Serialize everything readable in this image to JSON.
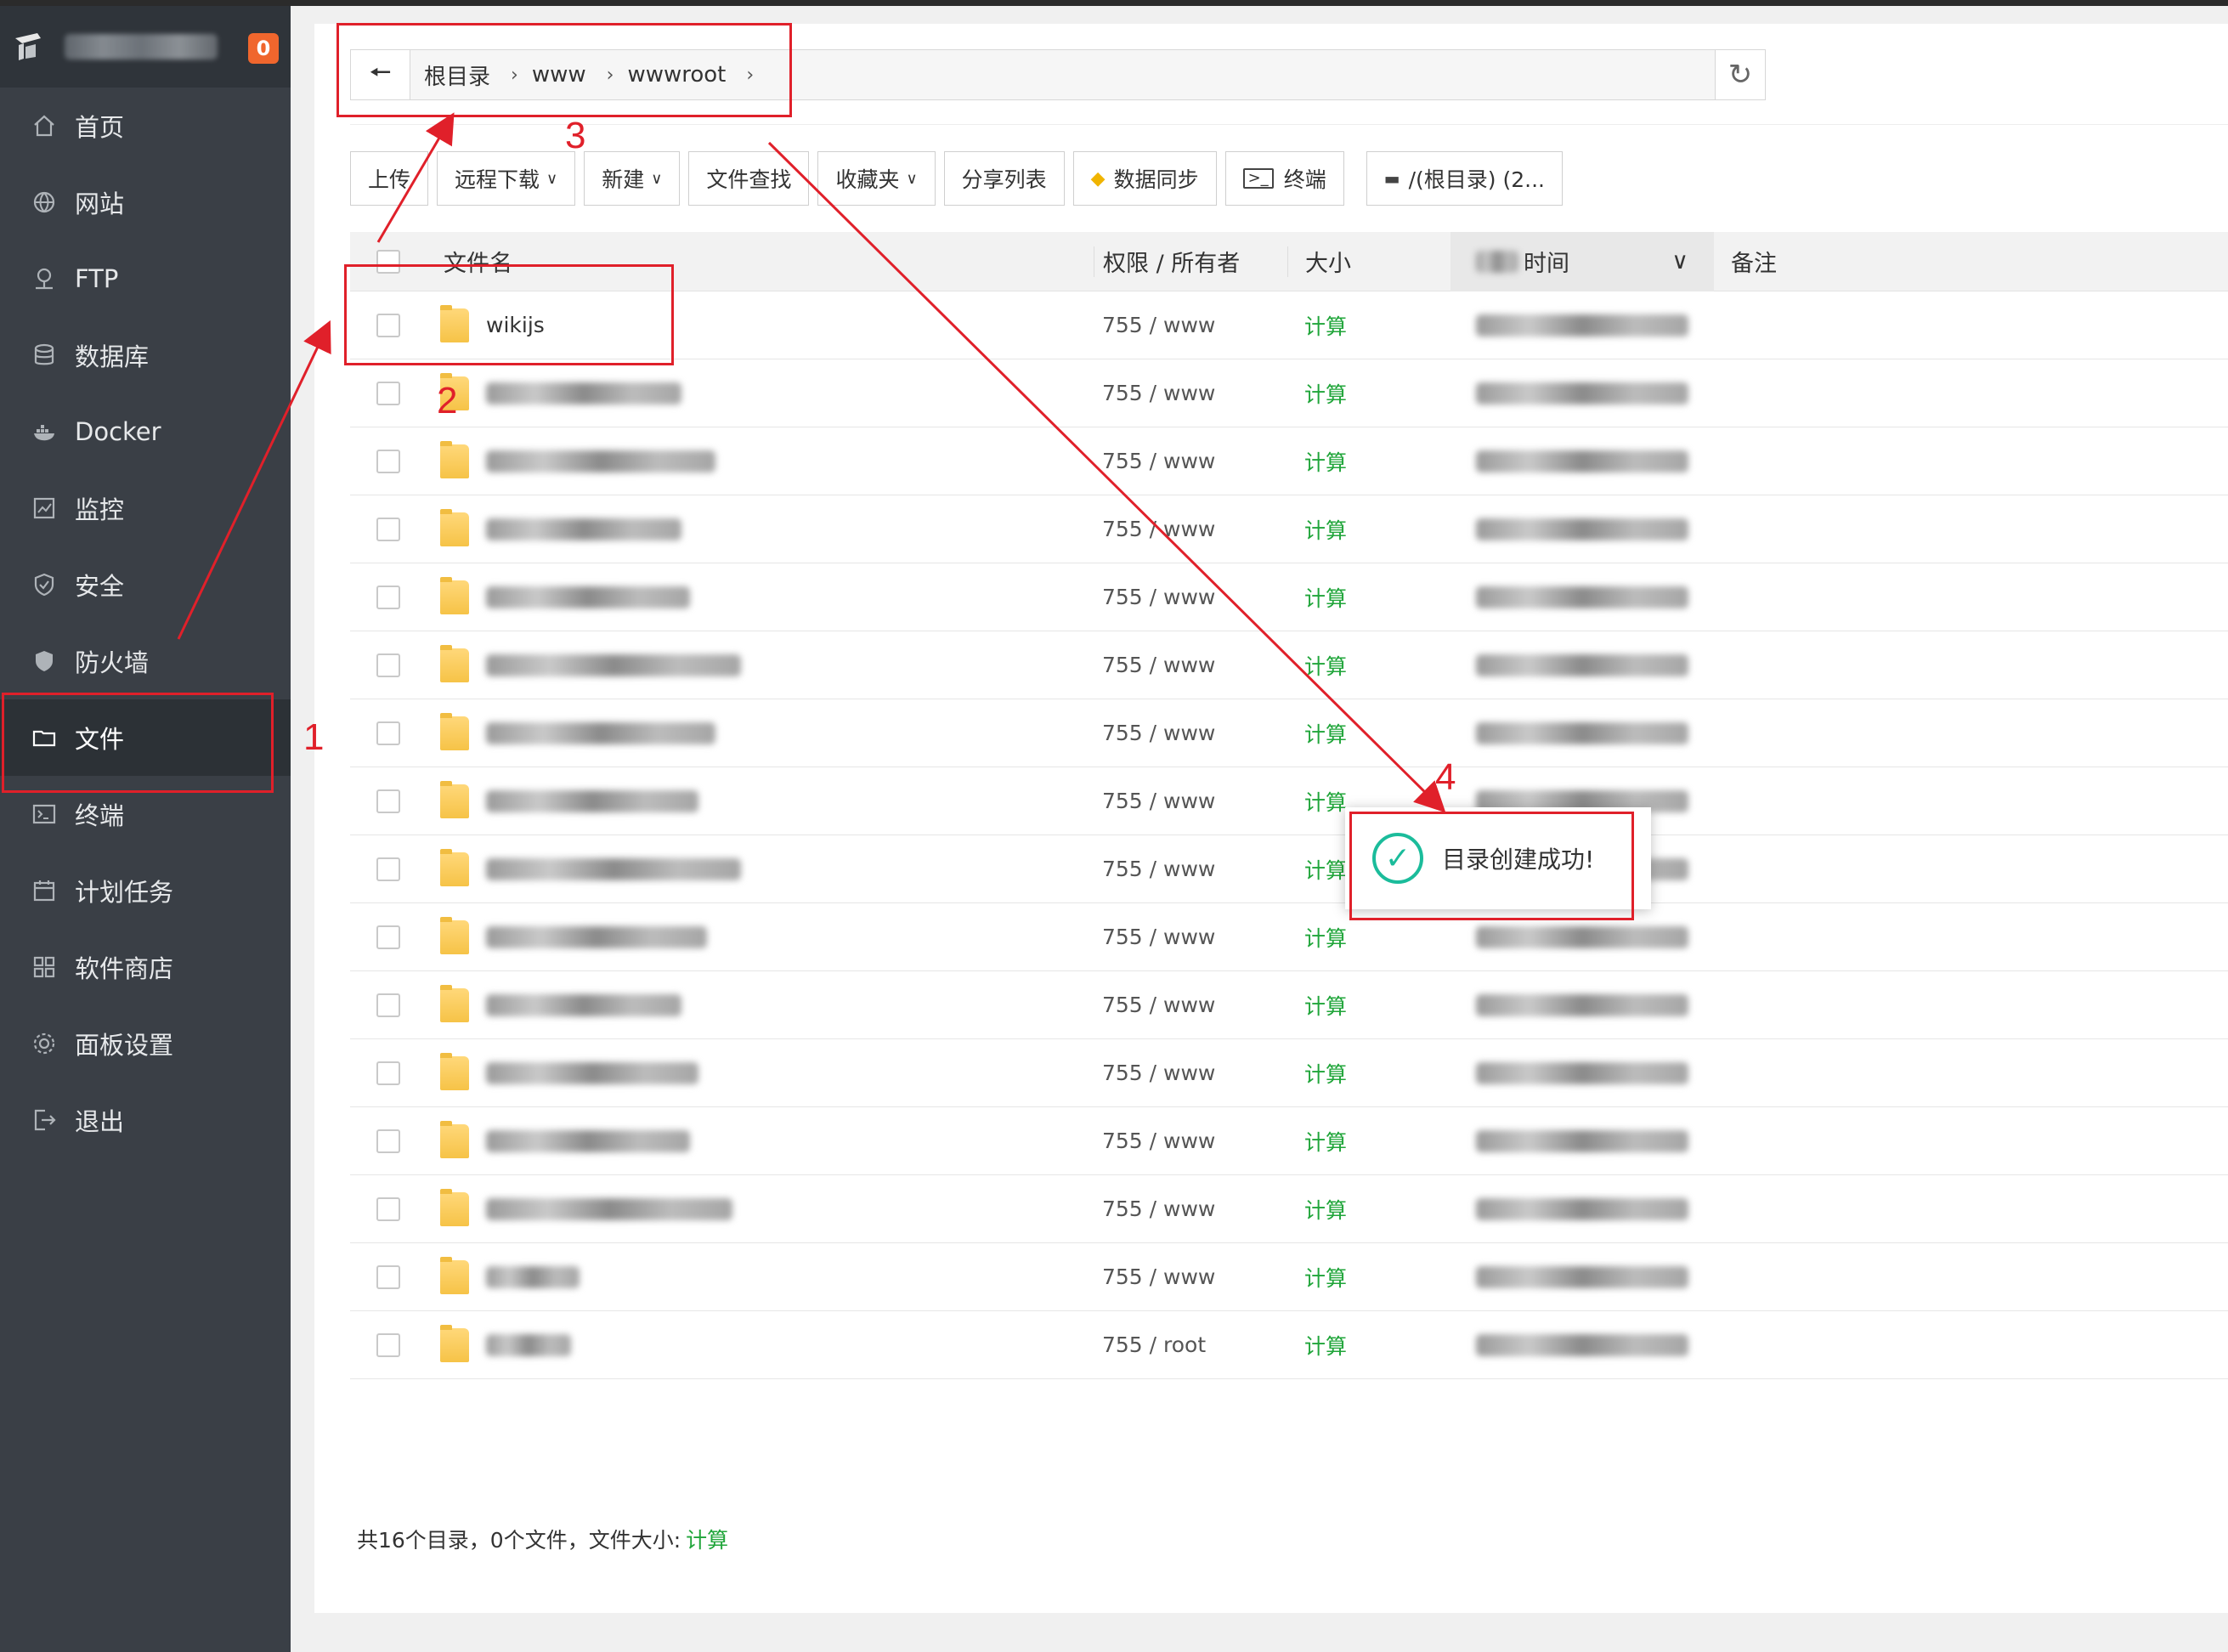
{
  "sidebar": {
    "badge": "0",
    "items": [
      {
        "label": "首页",
        "icon": "home-icon"
      },
      {
        "label": "网站",
        "icon": "globe-icon"
      },
      {
        "label": "FTP",
        "icon": "ftp-icon"
      },
      {
        "label": "数据库",
        "icon": "database-icon"
      },
      {
        "label": "Docker",
        "icon": "docker-icon"
      },
      {
        "label": "监控",
        "icon": "monitor-icon"
      },
      {
        "label": "安全",
        "icon": "shield-icon"
      },
      {
        "label": "防火墙",
        "icon": "firewall-icon"
      },
      {
        "label": "文件",
        "icon": "folder-icon"
      },
      {
        "label": "终端",
        "icon": "terminal-icon"
      },
      {
        "label": "计划任务",
        "icon": "calendar-icon"
      },
      {
        "label": "软件商店",
        "icon": "grid-icon"
      },
      {
        "label": "面板设置",
        "icon": "gear-icon"
      },
      {
        "label": "退出",
        "icon": "logout-icon"
      }
    ]
  },
  "path": {
    "crumbs": [
      "根目录",
      "www",
      "wwwroot"
    ]
  },
  "toolbar": {
    "upload": "上传",
    "remote_download": "远程下载",
    "new": "新建",
    "search": "文件查找",
    "favorites": "收藏夹",
    "share_list": "分享列表",
    "sync": "数据同步",
    "terminal": "终端",
    "disk": "/(根目录) (2..."
  },
  "table": {
    "headers": {
      "name": "文件名",
      "perm": "权限 / 所有者",
      "size": "大小",
      "time": "时间",
      "note": "备注"
    },
    "rows": [
      {
        "name": "wikijs",
        "perm": "755 / www",
        "size": "计算"
      },
      {
        "name": "",
        "perm": "755 / www",
        "size": "计算"
      },
      {
        "name": "",
        "perm": "755 / www",
        "size": "计算"
      },
      {
        "name": "",
        "perm": "755 / www",
        "size": "计算"
      },
      {
        "name": "",
        "perm": "755 / www",
        "size": "计算"
      },
      {
        "name": "",
        "perm": "755 / www",
        "size": "计算"
      },
      {
        "name": "",
        "perm": "755 / www",
        "size": "计算"
      },
      {
        "name": "",
        "perm": "755 / www",
        "size": "计算"
      },
      {
        "name": "",
        "perm": "755 / www",
        "size": "计算"
      },
      {
        "name": "",
        "perm": "755 / www",
        "size": "计算"
      },
      {
        "name": "",
        "perm": "755 / www",
        "size": "计算"
      },
      {
        "name": "",
        "perm": "755 / www",
        "size": "计算"
      },
      {
        "name": "",
        "perm": "755 / www",
        "size": "计算"
      },
      {
        "name": "",
        "perm": "755 / www",
        "size": "计算"
      },
      {
        "name": "",
        "perm": "755 / www",
        "size": "计算"
      },
      {
        "name": "",
        "perm": "755 / root",
        "size": "计算"
      }
    ]
  },
  "summary": {
    "text": "共16个目录，0个文件，文件大小:",
    "calc": "计算"
  },
  "toast": {
    "message": "目录创建成功!"
  },
  "annotations": [
    "1",
    "2",
    "3",
    "4"
  ],
  "colors": {
    "sidebar_bg": "#3a3f46",
    "accent_green": "#20a53a",
    "annotation_red": "#e0202a",
    "badge_orange": "#f0662d",
    "success_teal": "#1bbc9b"
  }
}
